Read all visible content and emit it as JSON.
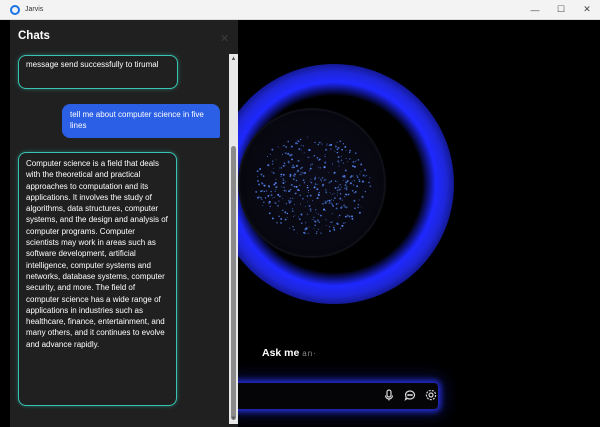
{
  "window": {
    "title": "Jarvis",
    "controls": {
      "minimize": "—",
      "maximize": "☐",
      "close": "✕"
    }
  },
  "chat": {
    "title": "Chats",
    "close_glyph": "✕",
    "messages": [
      {
        "role": "bot",
        "text": "message send successfully to tirumal"
      },
      {
        "role": "user",
        "text": "tell me about computer science in five lines"
      },
      {
        "role": "bot",
        "text": "Computer science is a field that deals with the theoretical and practical approaches to computation and its applications. It involves the study of algorithms, data structures, computer systems, and the design and analysis of computer programs. Computer scientists may work in areas such as software development, artificial intelligence, computer systems and networks, database systems, computer security, and more. The field of computer science has a wide range of applications in industries such as healthcare, finance, entertainment, and many others, and it continues to evolve and advance rapidly."
      }
    ]
  },
  "assistant": {
    "prompt_main": "Ask me",
    "prompt_faded": "an·",
    "icons": [
      "microphone-icon",
      "chat-icon",
      "settings-icon"
    ]
  },
  "colors": {
    "accent_teal": "#39c3b3",
    "user_bubble": "#2a5fe6",
    "glow_blue": "#2030ff",
    "panel_bg": "#202020"
  }
}
